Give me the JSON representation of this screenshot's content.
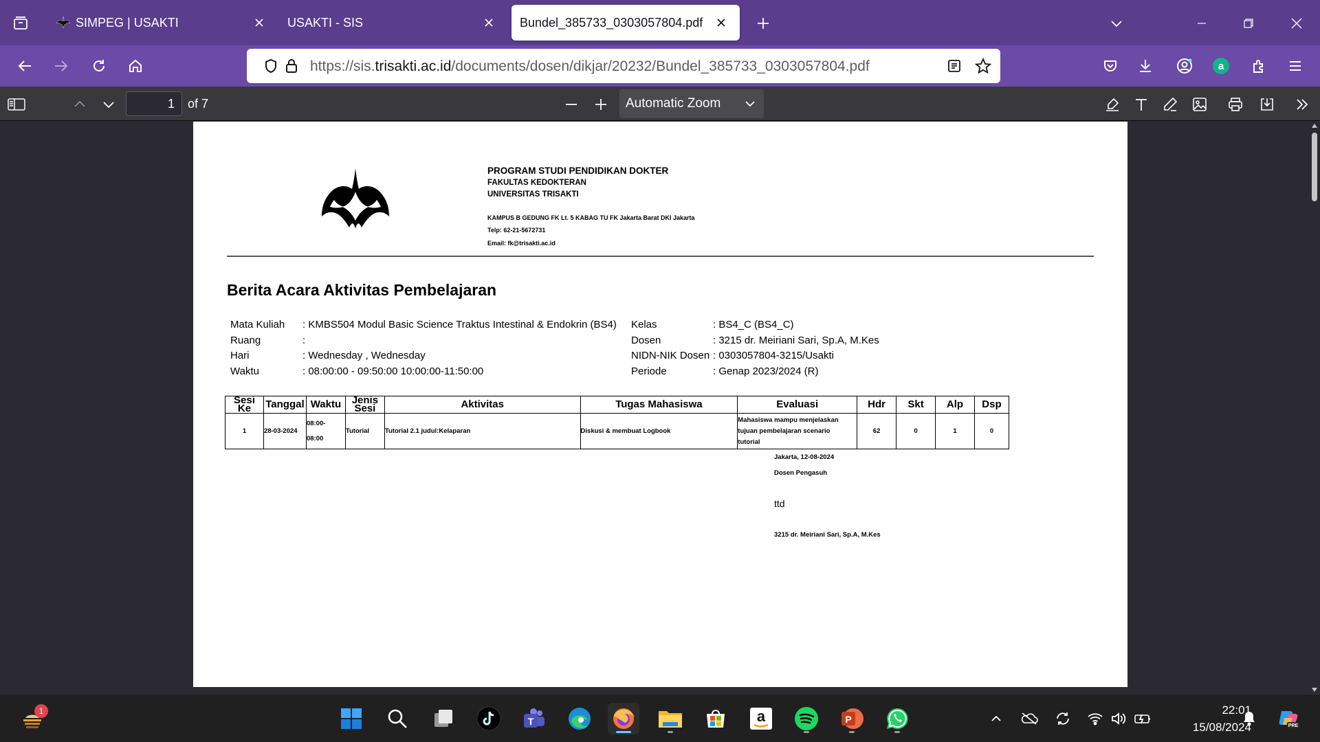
{
  "tabs": [
    {
      "label": "SIMPEG | USAKTI"
    },
    {
      "label": "USAKTI - SIS"
    },
    {
      "label": "Bundel_385733_0303057804.pdf"
    }
  ],
  "address": {
    "scheme": "https://sis.",
    "host": "trisakti.ac.id",
    "path": "/documents/dosen/dikjar/20232/Bundel_385733_0303057804.pdf"
  },
  "pdf_toolbar": {
    "page_number": "1",
    "page_of": "of 7",
    "zoom": "Automatic Zoom"
  },
  "letterhead": {
    "line1": "PROGRAM STUDI PENDIDIKAN DOKTER",
    "line2": "FAKULTAS KEDOKTERAN",
    "line3": "UNIVERSITAS TRISAKTI",
    "address": "KAMPUS B GEDUNG FK Lt. 5 KABAG TU FK Jakarta Barat DKI Jakarta",
    "phone": "Telp: 62-21-5672731",
    "email": "Email: fk@trisakti.ac.id"
  },
  "doc_title": "Berita Acara Aktivitas Pembelajaran",
  "info_left": [
    {
      "label": "Mata Kuliah",
      "value": ": KMBS504  Modul Basic Science Traktus Intestinal & Endokrin (BS4)"
    },
    {
      "label": "Ruang",
      "value": ":"
    },
    {
      "label": "Hari",
      "value": ": Wednesday , Wednesday"
    },
    {
      "label": "Waktu",
      "value": ": 08:00:00 - 09:50:00 10:00:00-11:50:00"
    }
  ],
  "info_right": [
    {
      "label": "Kelas",
      "value": ": BS4_C (BS4_C)"
    },
    {
      "label": "Dosen",
      "value": ": 3215 dr. Meiriani Sari, Sp.A, M.Kes"
    },
    {
      "label": "NIDN-NIK Dosen",
      "value": ": 0303057804-3215/Usakti"
    },
    {
      "label": "Periode",
      "value": ": Genap 2023/2024 (R)"
    }
  ],
  "table": {
    "headers": [
      "Sesi Ke",
      "Tanggal",
      "Waktu",
      "Jenis Sesi",
      "Aktivitas",
      "Tugas Mahasiswa",
      "Evaluasi",
      "Hdr",
      "Skt",
      "Alp",
      "Dsp"
    ],
    "header_sesi_1": "Sesi",
    "header_sesi_2": "Ke",
    "header_jenis_1": "Jenis",
    "header_jenis_2": "Sesi",
    "row": {
      "sesi": "1",
      "tanggal": "28-03-2024",
      "waktu_1": "08:00-",
      "waktu_2": "08:00",
      "jenis": "Tutorial",
      "aktivitas": "Tutorial 2.1 judul:Kelaparan",
      "tugas": "Diskusi & membuat Logbook",
      "evaluasi_1": "Mahasiswa mampu menjelaskan",
      "evaluasi_2": "tujuan pembelajaran scenario",
      "evaluasi_3": "tutorial",
      "hdr": "62",
      "skt": "0",
      "alp": "1",
      "dsp": "0"
    }
  },
  "signature": {
    "place_date": "Jakarta, 12-08-2024",
    "role": "Dosen Pengasuh",
    "ttd": "ttd",
    "name": "3215 dr. Meiriani Sari, Sp.A, M.Kes"
  },
  "taskbar": {
    "notification_badge": "1",
    "time": "22:01",
    "date": "15/08/2024"
  },
  "colors": {
    "tabbar": "#5a3d8c",
    "navbar": "#6b4aa8",
    "pdf_toolbar": "#38383d",
    "viewer_bg": "#2b2a33",
    "taskbar": "#202020"
  }
}
